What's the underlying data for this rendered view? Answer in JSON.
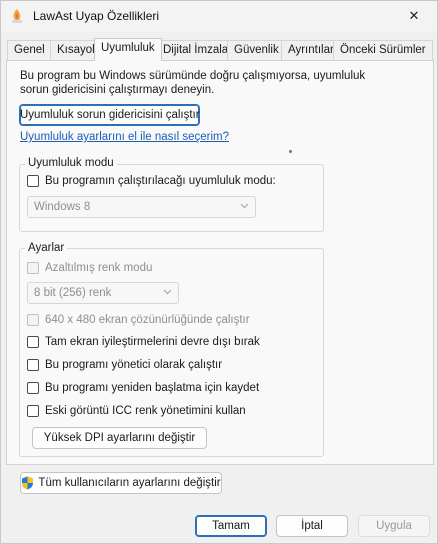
{
  "window": {
    "title": "LawAst Uyap Özellikleri",
    "close_glyph": "✕"
  },
  "tabs": [
    {
      "label": "Genel"
    },
    {
      "label": "Kısayol"
    },
    {
      "label": "Uyumluluk"
    },
    {
      "label": "Dijital İmzalar"
    },
    {
      "label": "Güvenlik"
    },
    {
      "label": "Ayrıntılar"
    },
    {
      "label": "Önceki Sürümler"
    }
  ],
  "active_tab": "Uyumluluk",
  "compat": {
    "description": "Bu program bu Windows sürümünde doğru çalışmıyorsa, uyumluluk sorun gidericisini çalıştırmayı deneyin.",
    "run_troubleshooter": "Uyumluluk sorun gidericisini çalıştır",
    "manual_link": "Uyumluluk ayarlarını el ile nasıl seçerim?",
    "mode_group": "Uyumluluk modu",
    "mode_checkbox": "Bu programın çalıştırılacağı uyumluluk modu:",
    "mode_checked": false,
    "mode_select": "Windows 8"
  },
  "settings": {
    "group": "Ayarlar",
    "reduced_color": "Azaltılmış renk modu",
    "color_select": "8 bit (256) renk",
    "res_640": "640 x 480 ekran çözünürlüğünde çalıştır",
    "fullscreen": "Tam ekran iyileştirmelerini devre dışı bırak",
    "admin": "Bu programı yönetici olarak çalıştır",
    "restart": "Bu programı yeniden başlatma için kaydet",
    "icc": "Eski görüntü ICC renk yönetimini kullan",
    "high_dpi": "Yüksek DPI ayarlarını değiştir"
  },
  "all_users_button": "Tüm kullanıcıların ayarlarını değiştir",
  "footer": {
    "ok": "Tamam",
    "cancel": "İptal",
    "apply": "Uygula"
  },
  "colors": {
    "accent": "#1a5fb4",
    "focus_border": "#2f6fb8",
    "shield_blue": "#2b79d6",
    "shield_yellow": "#f5c518"
  },
  "icons": {
    "app": "app-icon",
    "close": "close-icon",
    "dropdown": "chevron-down-icon",
    "uac": "uac-shield-icon"
  }
}
